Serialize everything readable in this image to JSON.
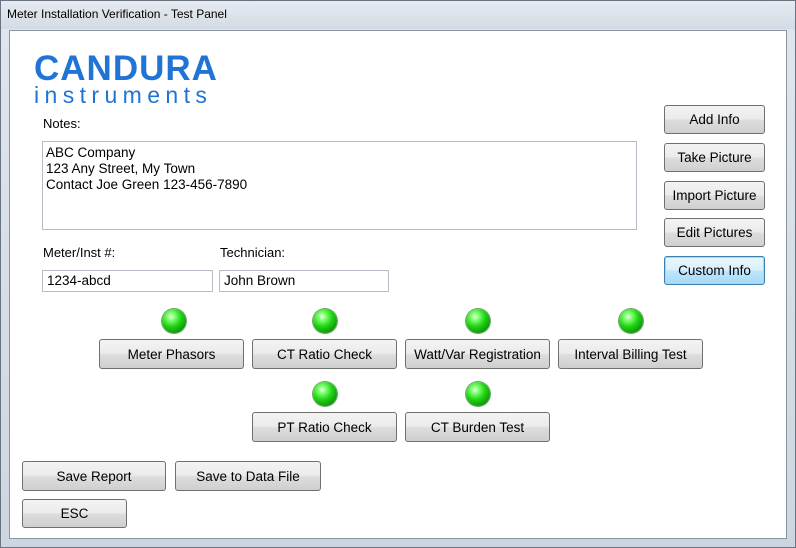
{
  "window": {
    "title": "Meter Installation Verification - Test Panel"
  },
  "logo": {
    "name": "CANDURA",
    "subtitle": "instruments"
  },
  "notes": {
    "label": "Notes:",
    "lines": [
      "ABC Company",
      "123 Any Street, My Town",
      "Contact Joe Green 123-456-7890"
    ]
  },
  "meter": {
    "label": "Meter/Inst #:",
    "value": "1234-abcd"
  },
  "technician": {
    "label": "Technician:",
    "value": "John Brown"
  },
  "side_buttons": {
    "add_info": "Add Info",
    "take_picture": "Take Picture",
    "import_picture": "Import Picture",
    "edit_pictures": "Edit Pictures",
    "custom_info": "Custom Info"
  },
  "tests": {
    "meter_phasors": "Meter Phasors",
    "ct_ratio_check": "CT Ratio Check",
    "watt_var_registration": "Watt/Var Registration",
    "interval_billing_test": "Interval Billing Test",
    "pt_ratio_check": "PT Ratio Check",
    "ct_burden_test": "CT Burden Test"
  },
  "bottom_buttons": {
    "save_report": "Save Report",
    "save_to_data_file": "Save to Data File",
    "esc": "ESC"
  },
  "colors": {
    "brand": "#1f74d6",
    "indicator_green": "#22d415"
  }
}
